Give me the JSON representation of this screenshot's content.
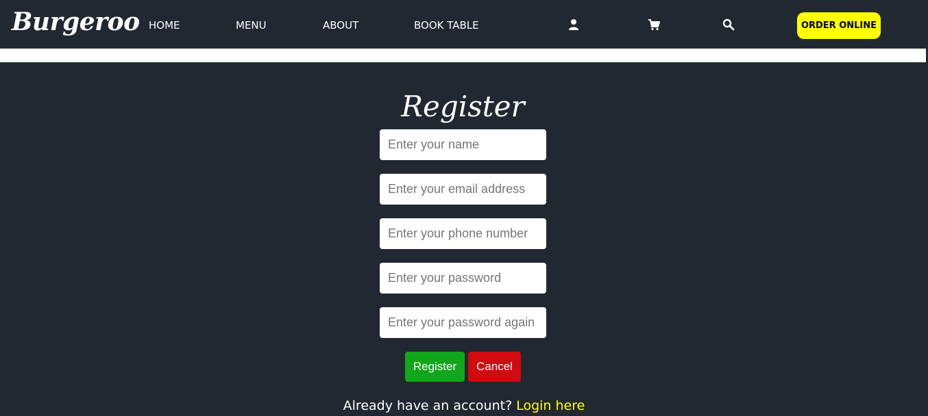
{
  "header": {
    "logo": "Burgeroo",
    "nav": {
      "home": "HOME",
      "menu": "MENU",
      "about": "ABOUT",
      "book_table": "BOOK TABLE"
    },
    "icons": [
      "user-icon",
      "cart-icon",
      "search-icon"
    ],
    "order_online": "ORDER ONLINE"
  },
  "form": {
    "title": "Register",
    "fields": {
      "name": {
        "placeholder": "Enter your name",
        "value": ""
      },
      "email": {
        "placeholder": "Enter your email address",
        "value": ""
      },
      "phone": {
        "placeholder": "Enter your phone number",
        "value": ""
      },
      "password": {
        "placeholder": "Enter your password",
        "value": ""
      },
      "password_again": {
        "placeholder": "Enter your password again",
        "value": ""
      }
    },
    "register_label": "Register",
    "cancel_label": "Cancel",
    "login_prompt": "Already have an account?",
    "login_link": "Login here"
  },
  "colors": {
    "background": "#222831",
    "accent_yellow": "#ffff00",
    "register_green": "#12a61b",
    "cancel_red": "#d10a0f"
  }
}
